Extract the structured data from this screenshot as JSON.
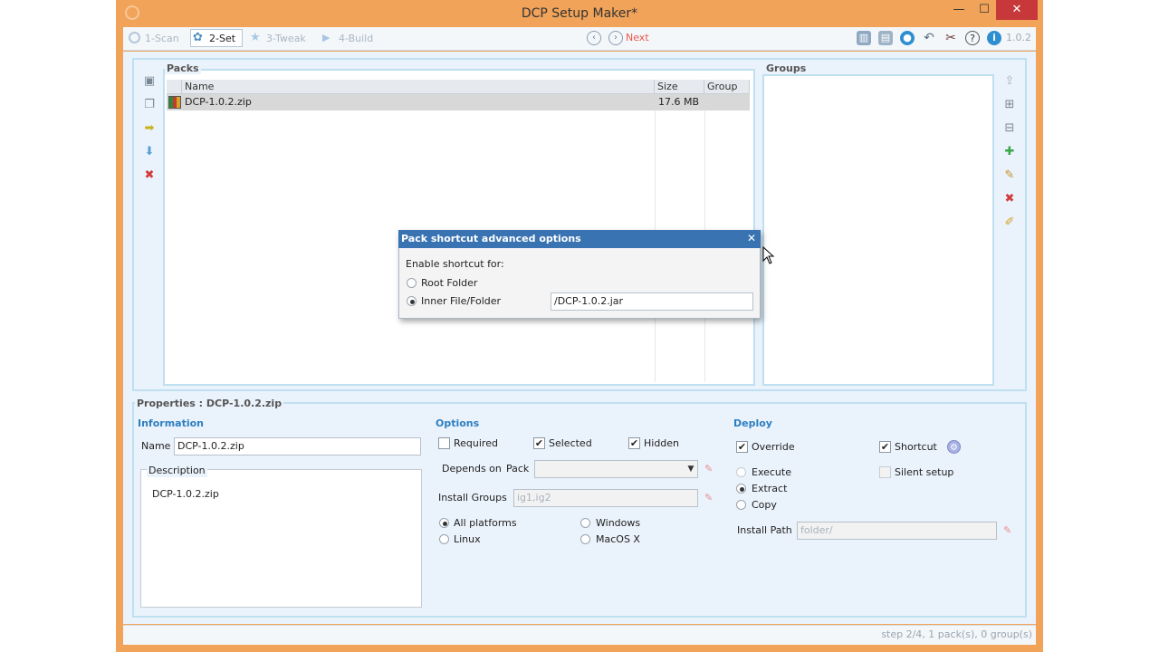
{
  "window": {
    "title": "DCP Setup Maker*",
    "minimize_glyph": "—",
    "maximize_glyph": "☐",
    "close_glyph": "✕"
  },
  "toolbar": {
    "steps": [
      {
        "label": "1-Scan",
        "icon": "magnifier-icon"
      },
      {
        "label": "2-Set",
        "icon": "gear-icon"
      },
      {
        "label": "3-Tweak",
        "icon": "star-icon"
      },
      {
        "label": "4-Build",
        "icon": "play-icon"
      }
    ],
    "prev_glyph": "‹",
    "next_glyph": "›",
    "next_label": "Next",
    "version": "1.0.2"
  },
  "packs": {
    "label": "Packs",
    "columns": {
      "name": "Name",
      "size": "Size",
      "group": "Group"
    },
    "rows": [
      {
        "name": "DCP-1.0.2.zip",
        "size": "17.6 MB",
        "group": ""
      }
    ]
  },
  "groups": {
    "label": "Groups"
  },
  "dialog": {
    "title": "Pack shortcut advanced options",
    "close_glyph": "✕",
    "enable_label": "Enable shortcut for:",
    "root_folder": "Root Folder",
    "inner_file": "Inner File/Folder",
    "inner_path": "/DCP-1.0.2.jar"
  },
  "properties": {
    "label": "Properties : DCP-1.0.2.zip",
    "information": {
      "label": "Information",
      "name_label": "Name",
      "name_value": "DCP-1.0.2.zip",
      "description_label": "Description",
      "description_value": "DCP-1.0.2.zip"
    },
    "options": {
      "label": "Options",
      "required": "Required",
      "selected": "Selected",
      "hidden": "Hidden",
      "depends_on": "Depends on",
      "pack": "Pack",
      "install_groups_label": "Install Groups",
      "install_groups_value": "ig1,ig2",
      "all_platforms": "All platforms",
      "windows": "Windows",
      "linux": "Linux",
      "macos": "MacOS X"
    },
    "deploy": {
      "label": "Deploy",
      "override": "Override",
      "shortcut": "Shortcut",
      "execute": "Execute",
      "silent_setup": "Silent setup",
      "extract": "Extract",
      "copy": "Copy",
      "install_path_label": "Install Path",
      "install_path_value": "folder/"
    }
  },
  "status": {
    "text": "step 2/4, 1 pack(s), 0 group(s)"
  },
  "colors": {
    "title_bar": "#f1a35a",
    "dialog_title": "#3973b2",
    "close_button": "#c7383a",
    "next": "#e8574a"
  }
}
